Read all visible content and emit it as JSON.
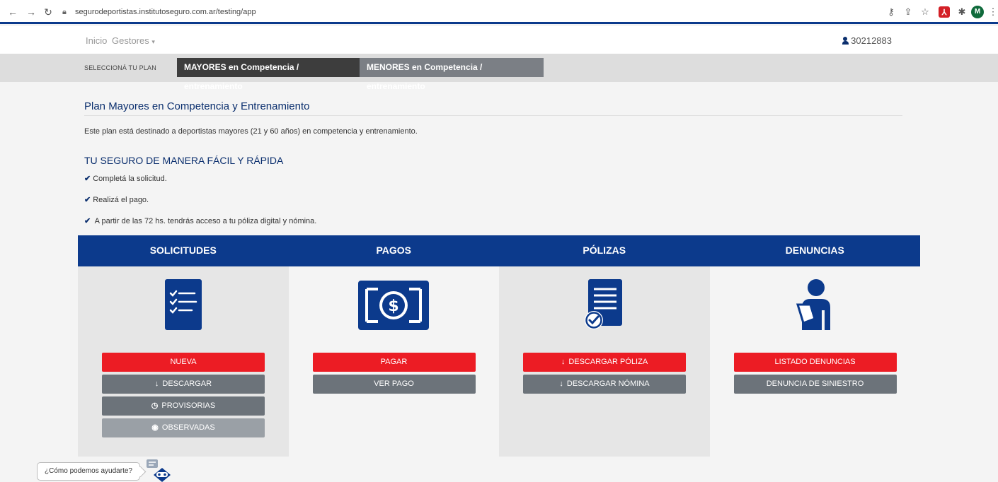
{
  "browser": {
    "url": "segurodeportistas.institutoseguro.com.ar/testing/app",
    "avatar_initial": "M"
  },
  "topnav": {
    "home": "Inicio",
    "managers": "Gestores",
    "user_id": "30212883"
  },
  "planbar": {
    "label": "SELECCIONÁ TU PLAN",
    "tabs": [
      {
        "label": "MAYORES en Competencia / entrenamiento",
        "active": true
      },
      {
        "label": "MENORES en Competencia / entrenamiento",
        "active": false
      }
    ]
  },
  "plan": {
    "title": "Plan Mayores en Competencia y Entrenamiento",
    "description": "Este plan está destinado a deportistas mayores (21 y 60 años) en competencia y entrenamiento.",
    "tagline": "TU SEGURO DE MANERA FÁCIL Y RÁPIDA",
    "steps": [
      "Completá la solicitud.",
      "Realizá el pago.",
      " A partir de las 72 hs. tendrás acceso a tu póliza digital y nómina."
    ]
  },
  "cards": {
    "solicitudes": {
      "title": "SOLICITUDES",
      "buttons": [
        "NUEVA",
        "DESCARGAR",
        "PROVISORIAS",
        "OBSERVADAS"
      ]
    },
    "pagos": {
      "title": "PAGOS",
      "buttons": [
        "PAGAR",
        "VER PAGO"
      ]
    },
    "polizas": {
      "title": "PÓLIZAS",
      "buttons": [
        "DESCARGAR PÓLIZA",
        "DESCARGAR NÓMINA"
      ]
    },
    "denuncias": {
      "title": "DENUNCIAS",
      "buttons": [
        "LISTADO DENUNCIAS",
        "DENUNCIA DE SINIESTRO"
      ]
    }
  },
  "chat": {
    "prompt": "¿Cómo podemos ayudarte?"
  },
  "colors": {
    "brand_blue": "#0c3a8c",
    "title_blue": "#0b2f6e",
    "action_red": "#ec1c24",
    "button_gray": "#6c737a"
  }
}
